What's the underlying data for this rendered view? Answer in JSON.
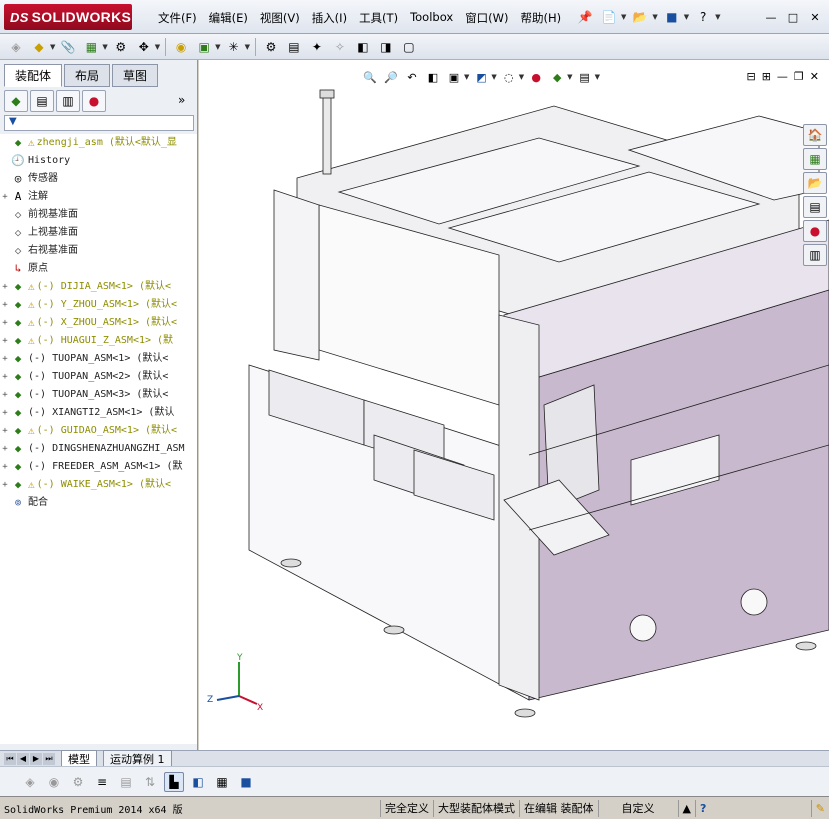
{
  "app": {
    "logo_ds": "DS",
    "logo_text": "SOLIDWORKS"
  },
  "menus": [
    "文件(F)",
    "编辑(E)",
    "视图(V)",
    "插入(I)",
    "工具(T)",
    "Toolbox",
    "窗口(W)",
    "帮助(H)"
  ],
  "window_controls": {
    "help": "?",
    "minimize": "—",
    "restore": "□",
    "close": "✕"
  },
  "left_panel": {
    "tabs": [
      "装配体",
      "布局",
      "草图"
    ],
    "active_tab": "装配体",
    "filter_symbol": "▼",
    "expand_symbol": "»"
  },
  "tree": [
    {
      "label": "zhengji_asm  (默认<默认_显",
      "icon": "assembly-icon",
      "warn": true,
      "style": "yellow",
      "expand": ""
    },
    {
      "label": "History",
      "icon": "history-icon",
      "warn": false,
      "style": "gray",
      "expand": ""
    },
    {
      "label": "传感器",
      "icon": "sensor-icon",
      "warn": false,
      "style": "gray",
      "expand": ""
    },
    {
      "label": "注解",
      "icon": "annotation-icon",
      "warn": false,
      "style": "gray",
      "expand": "+"
    },
    {
      "label": "前视基准面",
      "icon": "plane-icon",
      "warn": false,
      "style": "gray",
      "expand": ""
    },
    {
      "label": "上视基准面",
      "icon": "plane-icon",
      "warn": false,
      "style": "gray",
      "expand": ""
    },
    {
      "label": "右视基准面",
      "icon": "plane-icon",
      "warn": false,
      "style": "gray",
      "expand": ""
    },
    {
      "label": "原点",
      "icon": "origin-icon",
      "warn": false,
      "style": "gray",
      "expand": ""
    },
    {
      "label": "(-) DIJIA_ASM<1> (默认<",
      "icon": "assembly-icon",
      "warn": true,
      "style": "yellow",
      "expand": "+"
    },
    {
      "label": "(-) Y_ZHOU_ASM<1> (默认<",
      "icon": "assembly-icon",
      "warn": true,
      "style": "yellow",
      "expand": "+"
    },
    {
      "label": "(-) X_ZHOU_ASM<1> (默认<",
      "icon": "assembly-icon",
      "warn": true,
      "style": "yellow",
      "expand": "+"
    },
    {
      "label": "(-) HUAGUI_Z_ASM<1> (默",
      "icon": "assembly-icon",
      "warn": true,
      "style": "yellow",
      "expand": "+"
    },
    {
      "label": "(-) TUOPAN_ASM<1> (默认<",
      "icon": "assembly-icon",
      "warn": false,
      "style": "gray",
      "expand": "+"
    },
    {
      "label": "(-) TUOPAN_ASM<2> (默认<",
      "icon": "assembly-icon",
      "warn": false,
      "style": "gray",
      "expand": "+"
    },
    {
      "label": "(-) TUOPAN_ASM<3> (默认<",
      "icon": "assembly-icon",
      "warn": false,
      "style": "gray",
      "expand": "+"
    },
    {
      "label": "(-) XIANGTI2_ASM<1> (默认",
      "icon": "assembly-icon",
      "warn": false,
      "style": "gray",
      "expand": "+"
    },
    {
      "label": "(-) GUIDAO_ASM<1> (默认<",
      "icon": "assembly-icon",
      "warn": true,
      "style": "yellow",
      "expand": "+"
    },
    {
      "label": "(-) DINGSHENAZHUANGZHI_ASM",
      "icon": "assembly-icon",
      "warn": false,
      "style": "gray",
      "expand": "+"
    },
    {
      "label": "(-) FREEDER_ASM_ASM<1> (默",
      "icon": "assembly-icon",
      "warn": false,
      "style": "gray",
      "expand": "+"
    },
    {
      "label": "(-) WAIKE_ASM<1> (默认<",
      "icon": "assembly-icon",
      "warn": true,
      "style": "yellow",
      "expand": "+"
    },
    {
      "label": "配合",
      "icon": "mates-icon",
      "warn": false,
      "style": "gray",
      "expand": ""
    }
  ],
  "bottom_tabs": [
    "模型",
    "运动算例 1"
  ],
  "active_bottom_tab": "模型",
  "status": {
    "app": "SolidWorks Premium 2014 x64 版",
    "define": "完全定义",
    "mode": "大型装配体模式",
    "editing": "在编辑 装配体",
    "custom": "自定义",
    "help": "?"
  },
  "triad": {
    "x": "X",
    "y": "Y",
    "z": "Z"
  },
  "colors": {
    "brand": "#c8102e",
    "machine_body": "#e9e3ee",
    "machine_side": "#c9b9cf",
    "warning": "#c89000",
    "tree_yellow": "#8e8e00"
  }
}
